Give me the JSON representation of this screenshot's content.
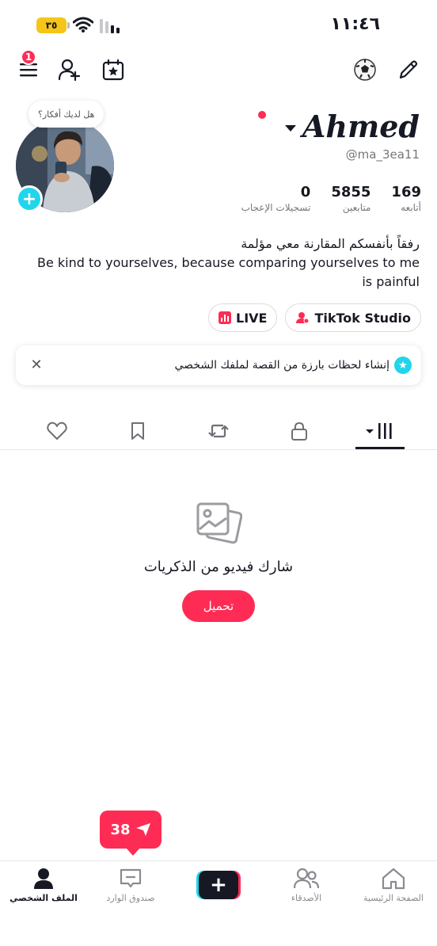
{
  "status_bar": {
    "time": "١١:٤٦",
    "battery": "٣٥"
  },
  "top_nav": {
    "menu_badge": "1"
  },
  "profile": {
    "thought_prompt": "هل لديك أفكار؟",
    "display_name": "Ahmed",
    "handle": "@ma_3ea11",
    "stats": [
      {
        "value": "169",
        "label": "أتابعه"
      },
      {
        "value": "5855",
        "label": "متابعين"
      },
      {
        "value": "0",
        "label": "تسجيلات الإعجاب"
      }
    ],
    "bio_line1": "رفقاً بأنفسكم المقارنة معي مؤلمة",
    "bio_line2": "Be kind to yourselves, because comparing yourselves to me is painful",
    "pills": [
      {
        "label": "TikTok Studio"
      },
      {
        "label": "LIVE"
      }
    ]
  },
  "story_card": {
    "text": "إنشاء لحظات بارزة من القصة لملفك الشخصي"
  },
  "tabs": [
    {
      "name": "videos-grid",
      "icon": "grid-icon"
    },
    {
      "name": "private",
      "icon": "lock-icon"
    },
    {
      "name": "reposts",
      "icon": "repost-icon"
    },
    {
      "name": "favorites",
      "icon": "bookmark-icon"
    },
    {
      "name": "liked",
      "icon": "heart-icon"
    }
  ],
  "empty_state": {
    "title": "شارك فيديو من الذكريات",
    "button": "تحميل"
  },
  "inbox_popup": {
    "count": "38"
  },
  "bottom_nav": {
    "home": "الصفحة الرئيسية",
    "friends": "الأصدقاء",
    "inbox": "صندوق الوارد",
    "profile": "الملف الشخصي"
  },
  "colors": {
    "accent": "#fe2c55",
    "cyan": "#20d5ec",
    "text": "#161823",
    "muted": "#75777c"
  }
}
